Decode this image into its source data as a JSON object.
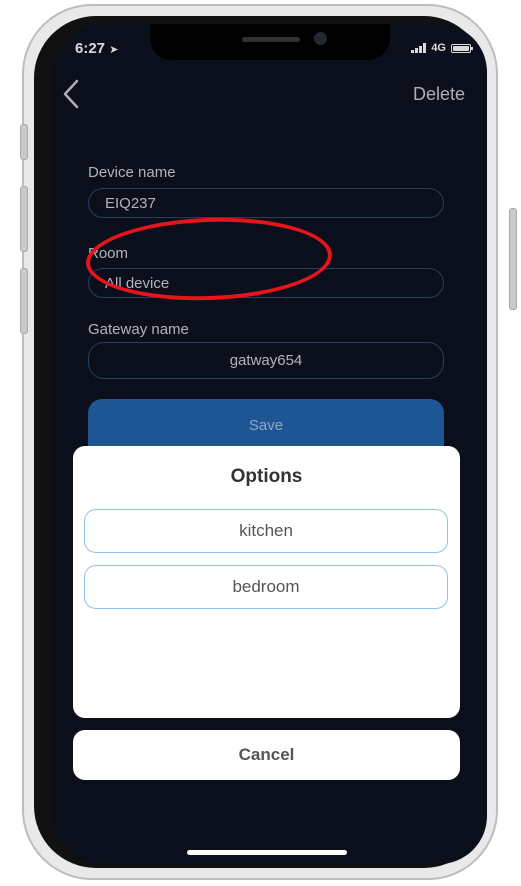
{
  "status_bar": {
    "time": "6:27",
    "network": "4G"
  },
  "header": {
    "delete_label": "Delete"
  },
  "form": {
    "device_name_label": "Device name",
    "device_name_value": "EIQ237",
    "room_label": "Room",
    "room_value": "All device",
    "gateway_label": "Gateway name",
    "gateway_value": "gatway654",
    "save_label": "Save"
  },
  "options_sheet": {
    "title": "Options",
    "options": [
      {
        "label": "kitchen"
      },
      {
        "label": "bedroom"
      }
    ],
    "cancel_label": "Cancel"
  },
  "colors": {
    "screen_bg": "#0d1221",
    "accent_button": "#2466b0",
    "option_border": "#8ec2ea",
    "annotation": "#e8141b"
  }
}
